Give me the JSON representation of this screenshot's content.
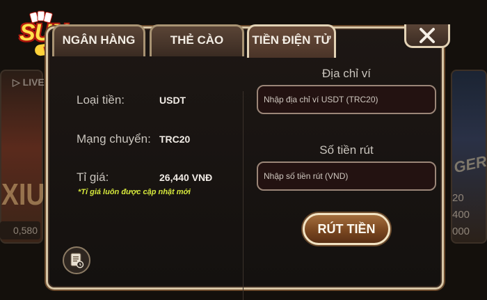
{
  "background": {
    "live_label": "LIVE",
    "left_game_label": "XIU",
    "left_amount": "0,580",
    "right_amounts": [
      "20",
      "400",
      "000"
    ]
  },
  "tabs": [
    {
      "label": "NGÂN HÀNG",
      "active": false
    },
    {
      "label": "THẺ CÀO",
      "active": false
    },
    {
      "label": "TIỀN ĐIỆN TỬ",
      "active": true
    }
  ],
  "info": {
    "currency_label": "Loại tiền:",
    "currency_value": "USDT",
    "network_label": "Mạng chuyển:",
    "network_value": "TRC20",
    "rate_label": "Tỉ giá:",
    "rate_value": "26,440 VNĐ",
    "rate_note": "*Tỉ giá luôn được cập nhật mới"
  },
  "form": {
    "address_label": "Địa chỉ ví",
    "address_placeholder": "Nhập địa chỉ ví USDT (TRC20)",
    "amount_label": "Số tiền rút",
    "amount_placeholder": "Nhập số tiền rút (VND)",
    "submit_label": "RÚT TIỀN"
  },
  "colors": {
    "accent_gold": "#d8c6a6",
    "note_yellow": "#d6e83c",
    "button_brown": "#7a4720"
  },
  "icons": {
    "close": "close-icon",
    "history": "history-document-icon"
  }
}
